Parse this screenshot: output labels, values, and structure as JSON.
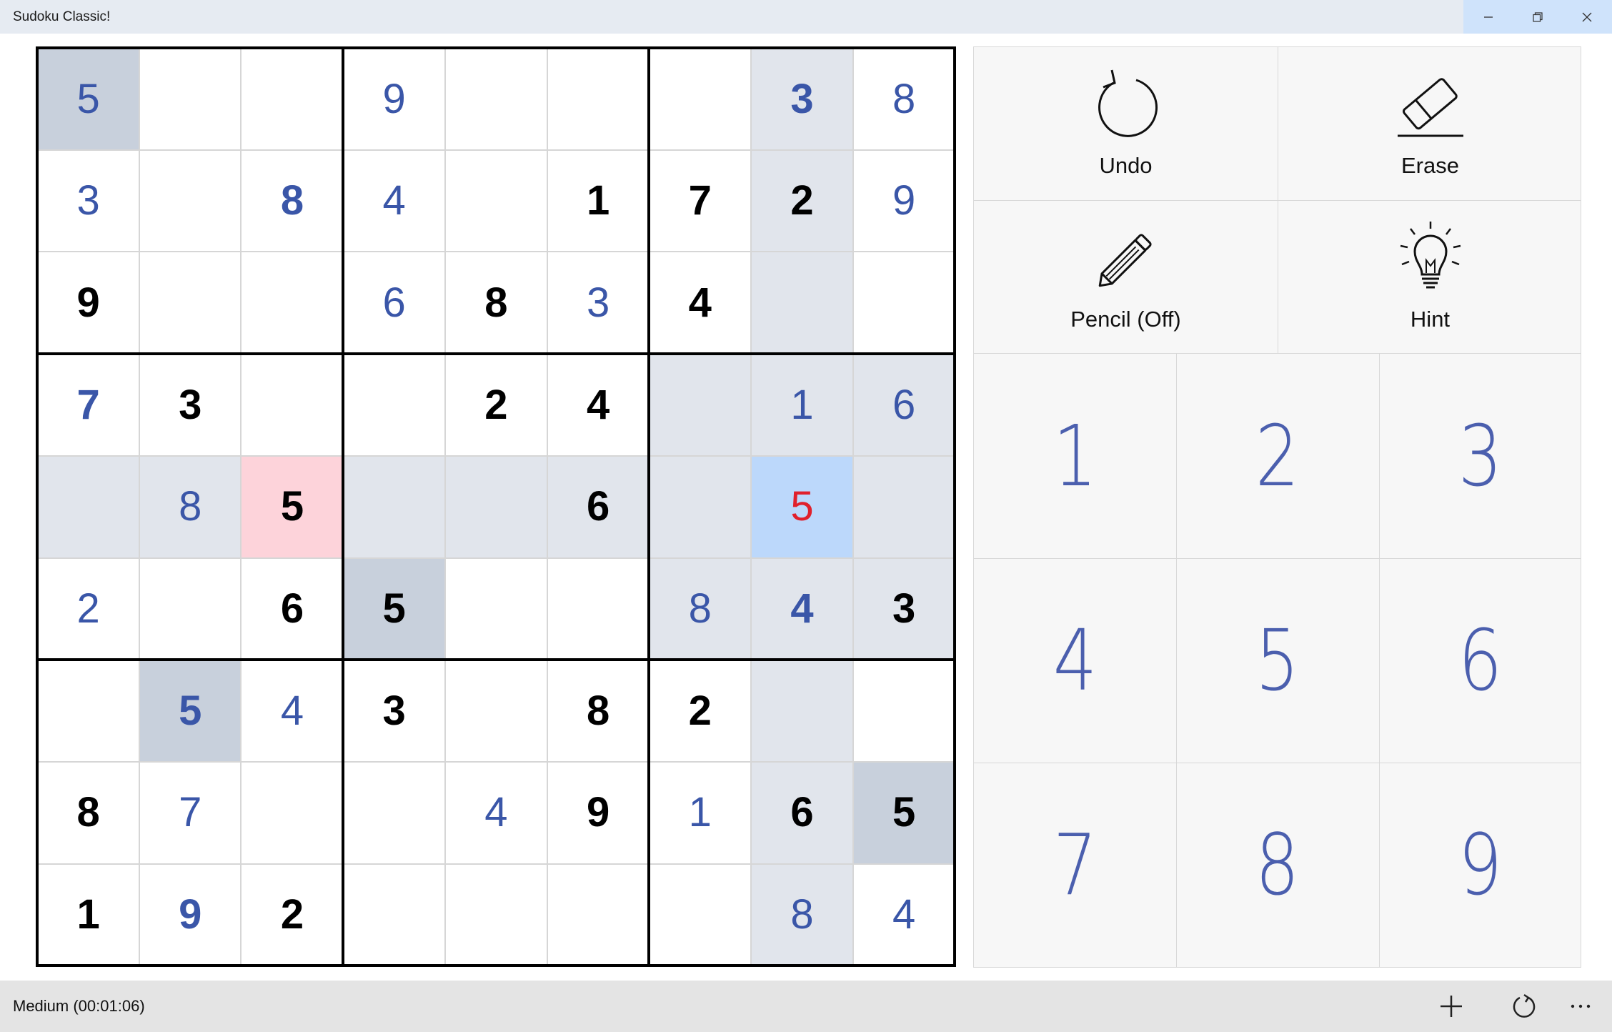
{
  "window": {
    "title": "Sudoku Classic!",
    "controls": [
      "minimize-icon",
      "restore-icon",
      "close-icon"
    ]
  },
  "tools": {
    "undo_label": "Undo",
    "erase_label": "Erase",
    "pencil_label": "Pencil (Off)",
    "hint_label": "Hint"
  },
  "numpad": [
    "1",
    "2",
    "3",
    "4",
    "5",
    "6",
    "7",
    "8",
    "9"
  ],
  "status": {
    "text": "Medium (00:01:06)"
  },
  "bottom_actions": [
    "new-game-icon",
    "restart-icon",
    "more-icon"
  ],
  "colors": {
    "given": "#000000",
    "user_entry": "#3a56a8",
    "error": "#e0202c",
    "highlight_same_digit": "#c8d0dc",
    "highlight_row_col_box": "#e1e5ec",
    "selected_cell": "#bcd8fb",
    "conflict_cell": "#fdd3da"
  },
  "board": {
    "selected": [
      4,
      7
    ],
    "cells": [
      [
        {
          "v": "5",
          "t": "user",
          "bg": "same"
        },
        {
          "v": "",
          "t": "",
          "bg": ""
        },
        {
          "v": "",
          "t": "",
          "bg": ""
        },
        {
          "v": "9",
          "t": "user",
          "bg": ""
        },
        {
          "v": "",
          "t": "",
          "bg": ""
        },
        {
          "v": "",
          "t": "",
          "bg": ""
        },
        {
          "v": "",
          "t": "",
          "bg": ""
        },
        {
          "v": "3",
          "t": "user-strong",
          "bg": "hl"
        },
        {
          "v": "8",
          "t": "user",
          "bg": ""
        }
      ],
      [
        {
          "v": "3",
          "t": "user",
          "bg": ""
        },
        {
          "v": "",
          "t": "",
          "bg": ""
        },
        {
          "v": "8",
          "t": "user-strong",
          "bg": ""
        },
        {
          "v": "4",
          "t": "user",
          "bg": ""
        },
        {
          "v": "",
          "t": "",
          "bg": ""
        },
        {
          "v": "1",
          "t": "given",
          "bg": ""
        },
        {
          "v": "7",
          "t": "given",
          "bg": ""
        },
        {
          "v": "2",
          "t": "given",
          "bg": "hl"
        },
        {
          "v": "9",
          "t": "user",
          "bg": ""
        }
      ],
      [
        {
          "v": "9",
          "t": "given",
          "bg": ""
        },
        {
          "v": "",
          "t": "",
          "bg": ""
        },
        {
          "v": "",
          "t": "",
          "bg": ""
        },
        {
          "v": "6",
          "t": "user",
          "bg": ""
        },
        {
          "v": "8",
          "t": "given",
          "bg": ""
        },
        {
          "v": "3",
          "t": "user",
          "bg": ""
        },
        {
          "v": "4",
          "t": "given",
          "bg": ""
        },
        {
          "v": "",
          "t": "",
          "bg": "hl"
        },
        {
          "v": "",
          "t": "",
          "bg": ""
        }
      ],
      [
        {
          "v": "7",
          "t": "user-strong",
          "bg": ""
        },
        {
          "v": "3",
          "t": "given",
          "bg": ""
        },
        {
          "v": "",
          "t": "",
          "bg": ""
        },
        {
          "v": "",
          "t": "",
          "bg": ""
        },
        {
          "v": "2",
          "t": "given",
          "bg": ""
        },
        {
          "v": "4",
          "t": "given",
          "bg": ""
        },
        {
          "v": "",
          "t": "",
          "bg": "hl"
        },
        {
          "v": "1",
          "t": "user",
          "bg": "hl"
        },
        {
          "v": "6",
          "t": "user",
          "bg": "hl"
        }
      ],
      [
        {
          "v": "",
          "t": "",
          "bg": "hl"
        },
        {
          "v": "8",
          "t": "user",
          "bg": "hl"
        },
        {
          "v": "5",
          "t": "given",
          "bg": "conflict"
        },
        {
          "v": "",
          "t": "",
          "bg": "hl"
        },
        {
          "v": "",
          "t": "",
          "bg": "hl"
        },
        {
          "v": "6",
          "t": "given",
          "bg": "hl"
        },
        {
          "v": "",
          "t": "",
          "bg": "hl"
        },
        {
          "v": "5",
          "t": "error",
          "bg": "selected"
        },
        {
          "v": "",
          "t": "",
          "bg": "hl"
        }
      ],
      [
        {
          "v": "2",
          "t": "user",
          "bg": ""
        },
        {
          "v": "",
          "t": "",
          "bg": ""
        },
        {
          "v": "6",
          "t": "given",
          "bg": ""
        },
        {
          "v": "5",
          "t": "given",
          "bg": "same"
        },
        {
          "v": "",
          "t": "",
          "bg": ""
        },
        {
          "v": "",
          "t": "",
          "bg": ""
        },
        {
          "v": "8",
          "t": "user",
          "bg": "hl"
        },
        {
          "v": "4",
          "t": "user-strong",
          "bg": "hl"
        },
        {
          "v": "3",
          "t": "given",
          "bg": "hl"
        }
      ],
      [
        {
          "v": "",
          "t": "",
          "bg": ""
        },
        {
          "v": "5",
          "t": "user-strong",
          "bg": "same"
        },
        {
          "v": "4",
          "t": "user",
          "bg": ""
        },
        {
          "v": "3",
          "t": "given",
          "bg": ""
        },
        {
          "v": "",
          "t": "",
          "bg": ""
        },
        {
          "v": "8",
          "t": "given",
          "bg": ""
        },
        {
          "v": "2",
          "t": "given",
          "bg": ""
        },
        {
          "v": "",
          "t": "",
          "bg": "hl"
        },
        {
          "v": "",
          "t": "",
          "bg": ""
        }
      ],
      [
        {
          "v": "8",
          "t": "given",
          "bg": ""
        },
        {
          "v": "7",
          "t": "user",
          "bg": ""
        },
        {
          "v": "",
          "t": "",
          "bg": ""
        },
        {
          "v": "",
          "t": "",
          "bg": ""
        },
        {
          "v": "4",
          "t": "user",
          "bg": ""
        },
        {
          "v": "9",
          "t": "given",
          "bg": ""
        },
        {
          "v": "1",
          "t": "user",
          "bg": ""
        },
        {
          "v": "6",
          "t": "given",
          "bg": "hl"
        },
        {
          "v": "5",
          "t": "given",
          "bg": "same"
        }
      ],
      [
        {
          "v": "1",
          "t": "given",
          "bg": ""
        },
        {
          "v": "9",
          "t": "user-strong",
          "bg": ""
        },
        {
          "v": "2",
          "t": "given",
          "bg": ""
        },
        {
          "v": "",
          "t": "",
          "bg": ""
        },
        {
          "v": "",
          "t": "",
          "bg": ""
        },
        {
          "v": "",
          "t": "",
          "bg": ""
        },
        {
          "v": "",
          "t": "",
          "bg": ""
        },
        {
          "v": "8",
          "t": "user",
          "bg": "hl"
        },
        {
          "v": "4",
          "t": "user",
          "bg": ""
        }
      ]
    ]
  }
}
